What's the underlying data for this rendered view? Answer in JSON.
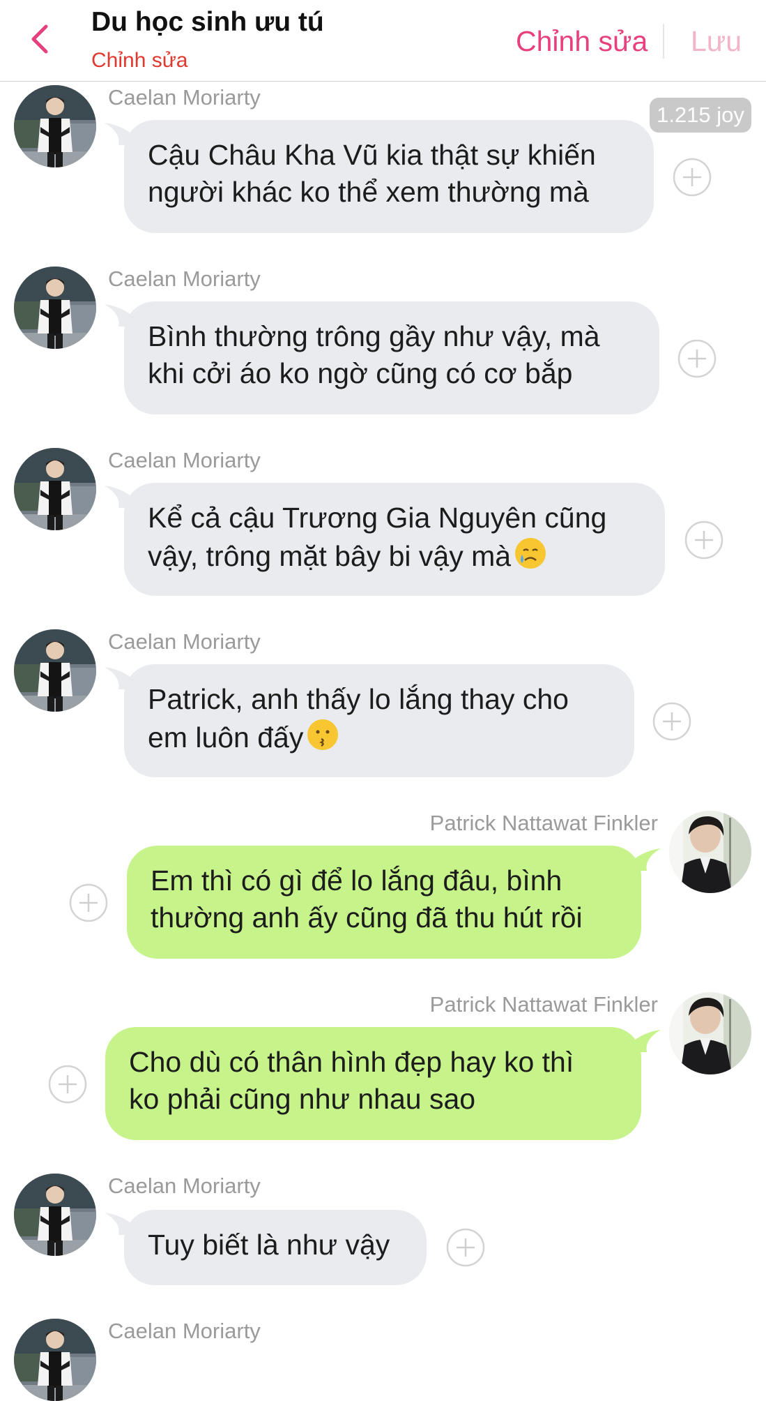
{
  "header": {
    "title": "Du học sinh ưu tú",
    "subtitle": "Chỉnh sửa",
    "edit_label": "Chỉnh sửa",
    "save_label": "Lưu"
  },
  "badge": {
    "joy_count": "1.215 joy"
  },
  "messages": [
    {
      "sender": "Caelan Moriarty",
      "side": "left",
      "lines": [
        "Cậu Châu Kha Vũ kia thật sự khiến",
        "người khác ko thể xem thường mà"
      ]
    },
    {
      "sender": "Caelan Moriarty",
      "side": "left",
      "lines": [
        "Bình thường trông gầy như vậy, mà",
        "khi cởi áo ko ngờ cũng có cơ bắp"
      ]
    },
    {
      "sender": "Caelan Moriarty",
      "side": "left",
      "lines": [
        "Kể cả cậu Trương Gia Nguyên cũng",
        "vậy, trông mặt bây bi vậy mà"
      ],
      "emoji": "sad-tear-face"
    },
    {
      "sender": "Caelan Moriarty",
      "side": "left",
      "lines": [
        "Patrick, anh thấy lo lắng thay cho",
        "em luôn đấy"
      ],
      "emoji": "kissing-face"
    },
    {
      "sender": "Patrick Nattawat Finkler",
      "side": "right",
      "lines": [
        "Em thì có gì để lo lắng đâu, bình",
        "thường anh ấy cũng đã thu hút rồi"
      ]
    },
    {
      "sender": "Patrick Nattawat Finkler",
      "side": "right",
      "lines": [
        "Cho dù có thân hình đẹp hay ko thì",
        "ko phải cũng như nhau sao"
      ]
    },
    {
      "sender": "Caelan Moriarty",
      "side": "left",
      "lines": [
        "Tuy biết là như vậy"
      ]
    },
    {
      "sender": "Caelan Moriarty",
      "side": "left",
      "lines": []
    }
  ],
  "colors": {
    "accent_pink": "#e8407e",
    "subtitle_red": "#e0392f",
    "bubble_gray": "#e9ebee",
    "bubble_green": "#c6f48a"
  }
}
